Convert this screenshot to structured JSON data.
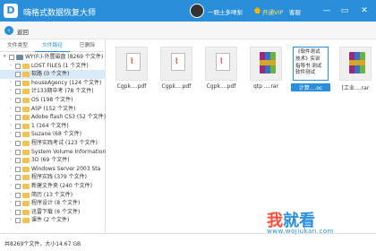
{
  "app": {
    "title": "嗨格式数据恢复大师",
    "logo_letter": "D",
    "username": "一颗土多啤梨",
    "vip_label": "开通VIP",
    "help_label": "客服",
    "minimize_glyph": "—",
    "restore_glyph": "▭",
    "close_glyph": "✕"
  },
  "nav": {
    "back_label": "返回",
    "back_glyph": "‹"
  },
  "sidebar": {
    "tabs": [
      {
        "label": "文件类型"
      },
      {
        "label": "文件路径"
      },
      {
        "label": "已删除"
      }
    ],
    "tree": [
      {
        "label": "WY(F:)-外置磁盘 (8269 个文件)",
        "indent": 0,
        "expand": "▾",
        "kind": "drive"
      },
      {
        "label": "LOST FILES (1 个文件)",
        "indent": 1,
        "expand": "›",
        "kind": "folder"
      },
      {
        "label": "软路 (0 个文件)",
        "indent": 1,
        "expand": "",
        "kind": "folder",
        "selected": true
      },
      {
        "label": "houseAgency (124 个文件)",
        "indent": 1,
        "expand": "›",
        "kind": "folder"
      },
      {
        "label": "计133期中考 (78 个文件)",
        "indent": 1,
        "expand": "›",
        "kind": "folder"
      },
      {
        "label": "OS (198 个文件)",
        "indent": 1,
        "expand": "›",
        "kind": "folder"
      },
      {
        "label": "ASP (152 个文件)",
        "indent": 1,
        "expand": "›",
        "kind": "folder"
      },
      {
        "label": "Adobe flash CS3 (52 个文件)",
        "indent": 1,
        "expand": "›",
        "kind": "folder"
      },
      {
        "label": "1 (164 个文件)",
        "indent": 1,
        "expand": "›",
        "kind": "folder"
      },
      {
        "label": "Suzane (68 个文件)",
        "indent": 1,
        "expand": "›",
        "kind": "folder"
      },
      {
        "label": "程序实践考试 (123 个文件)",
        "indent": 1,
        "expand": "›",
        "kind": "folder"
      },
      {
        "label": "System Volume Information",
        "indent": 1,
        "expand": "›",
        "kind": "folder"
      },
      {
        "label": "3D (69 个文件)",
        "indent": 1,
        "expand": "›",
        "kind": "folder"
      },
      {
        "label": "Windows Server 2003 Sta",
        "indent": 1,
        "expand": "›",
        "kind": "folder"
      },
      {
        "label": "程序实践 (379 个文件)",
        "indent": 1,
        "expand": "›",
        "kind": "folder"
      },
      {
        "label": "新建文件夹 (240 个文件)",
        "indent": 1,
        "expand": "›",
        "kind": "folder"
      },
      {
        "label": "简历 (13 个文件)",
        "indent": 1,
        "expand": "›",
        "kind": "folder"
      },
      {
        "label": "程序设计 (8 个文件)",
        "indent": 1,
        "expand": "›",
        "kind": "folder"
      },
      {
        "label": "迅雷下载 (6 个文件)",
        "indent": 1,
        "expand": "›",
        "kind": "folder"
      },
      {
        "label": "课件 (2 个文件)",
        "indent": 1,
        "expand": "›",
        "kind": "folder"
      }
    ]
  },
  "files": [
    {
      "name": "Cgpk....pdf",
      "type": "pdf"
    },
    {
      "name": "Cgpk....pdf",
      "type": "pdf"
    },
    {
      "name": "Cgpk....pdf",
      "type": "pdf"
    },
    {
      "name": "qtp ....rar",
      "type": "rar"
    },
    {
      "name": "计算....oc",
      "type": "doc",
      "highlight": true,
      "preview": [
        "《软件测试",
        "技术》实训",
        "指导书 测试",
        "软件测试"
      ]
    },
    {
      "name": "[工业....rar",
      "type": "rar"
    }
  ],
  "status": {
    "text": "共8269个文件，大小14.67 GB"
  },
  "watermark": {
    "line1a": "我",
    "line1b": "就看",
    "line2": "www.wojiukan.com"
  }
}
